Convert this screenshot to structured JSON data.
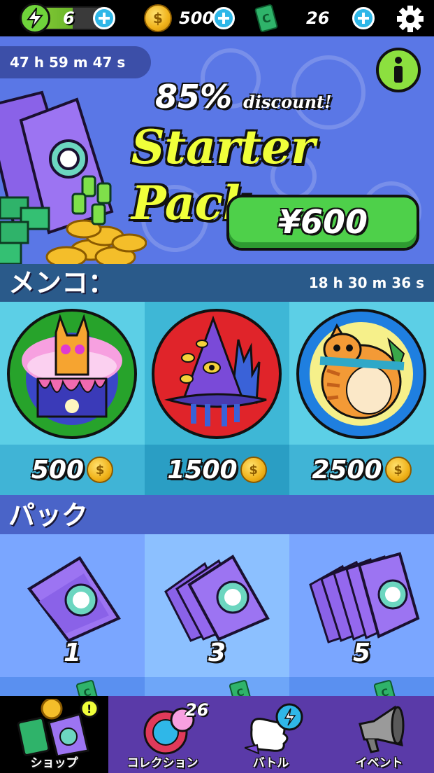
{
  "topbar": {
    "energy": "6",
    "coins": "500",
    "cash": "26",
    "icons": [
      "lightning-icon",
      "coin-icon",
      "cash-icon",
      "gear-icon",
      "plus-icon"
    ]
  },
  "banner": {
    "timer": "47 h 59 m 47 s",
    "discount": "85%",
    "discount_suffix": "discount!",
    "title": "Starter Pack",
    "price": "¥600"
  },
  "menko_section": {
    "title": "メンコ：",
    "timer": "18 h 30 m 36 s",
    "items": [
      {
        "price": "500",
        "bg": "#5ccfe6",
        "price_bg": "#40b4d6",
        "ring": "#27a32b"
      },
      {
        "price": "1500",
        "bg": "#3eb7d6",
        "price_bg": "#2a9ec4",
        "ring": "#e0242a"
      },
      {
        "price": "2500",
        "bg": "#5ccfe6",
        "price_bg": "#40b4d6",
        "ring": "#1f7fe0"
      }
    ]
  },
  "pack_section": {
    "title": "パック",
    "items": [
      {
        "count": "1",
        "price": "",
        "bg": "#7aa6ff"
      },
      {
        "count": "3",
        "price": "",
        "bg": "#8cc0ff"
      },
      {
        "count": "5",
        "price": "",
        "bg": "#7aa6ff"
      }
    ]
  },
  "nav": {
    "tabs": [
      {
        "label": "ショップ",
        "active": true
      },
      {
        "label": "コレクション",
        "badge": "26"
      },
      {
        "label": "バトル"
      },
      {
        "label": "イベント"
      }
    ]
  },
  "colors": {
    "banner_bg": "#5a77e6",
    "menko_header": "#2a5a8a",
    "pack_header": "#4a64c8",
    "nav_bg": "#5a3aa8",
    "accent_green": "#4ed04a",
    "title_yellow": "#f0ff3a"
  }
}
